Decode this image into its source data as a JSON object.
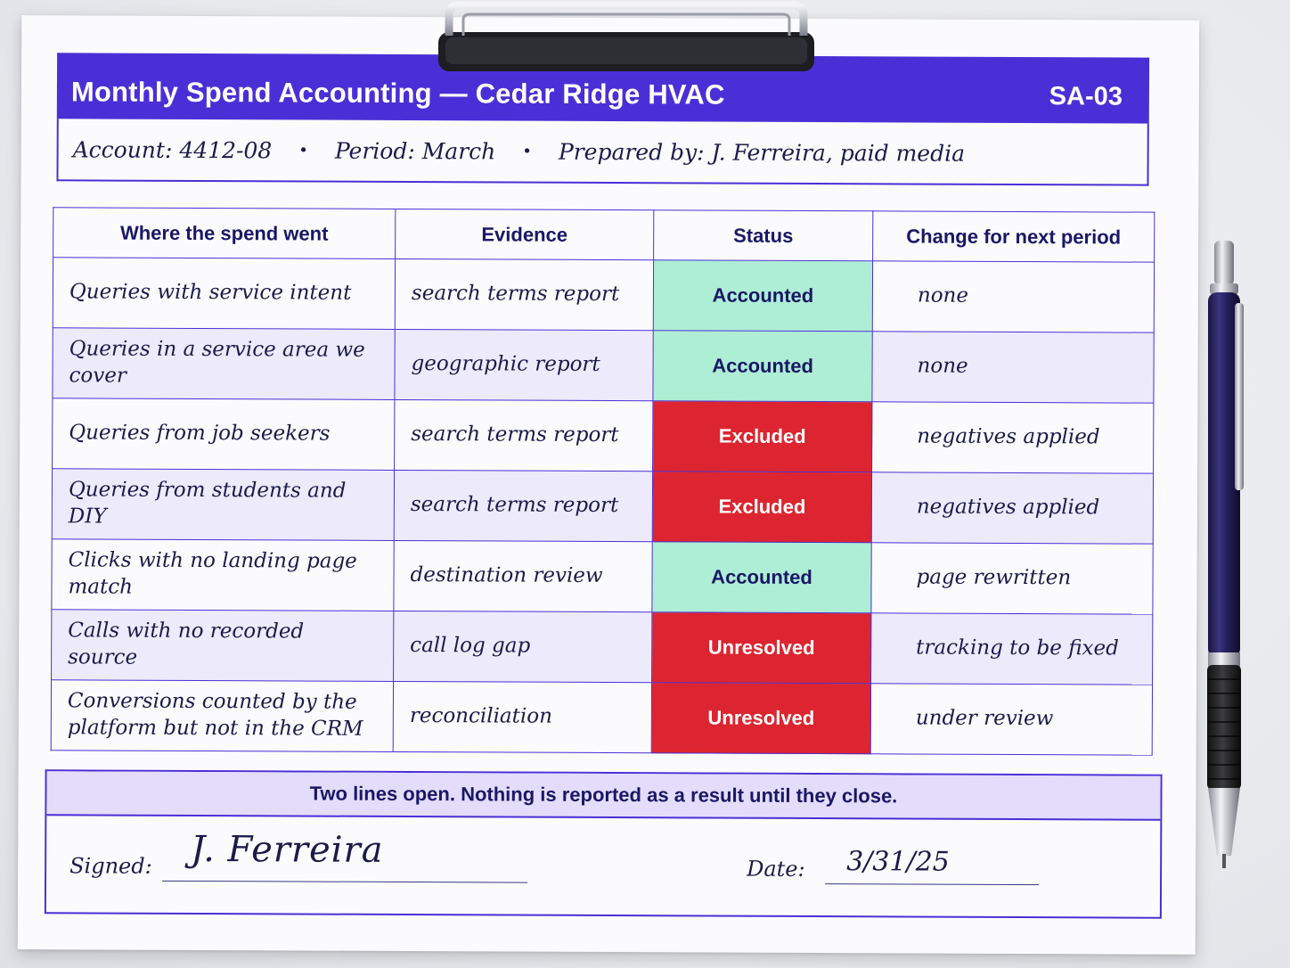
{
  "header": {
    "title": "Monthly Spend Accounting — Cedar Ridge HVAC",
    "code": "SA-03"
  },
  "meta": {
    "account": "Account: 4412-08",
    "period": "Period: March",
    "prepared_by": "Prepared by: J. Ferreira, paid media",
    "separator": "•"
  },
  "table": {
    "columns": [
      "Where the spend went",
      "Evidence",
      "Status",
      "Change for next period"
    ],
    "rows": [
      {
        "where": "Queries with service intent",
        "evidence": "search terms report",
        "status": "Accounted",
        "change": "none"
      },
      {
        "where": "Queries in a service area we cover",
        "evidence": "geographic report",
        "status": "Accounted",
        "change": "none"
      },
      {
        "where": "Queries from job seekers",
        "evidence": "search terms report",
        "status": "Excluded",
        "change": "negatives applied"
      },
      {
        "where": "Queries from students and DIY",
        "evidence": "search terms report",
        "status": "Excluded",
        "change": "negatives applied"
      },
      {
        "where": "Clicks with no landing page match",
        "evidence": "destination review",
        "status": "Accounted",
        "change": "page rewritten"
      },
      {
        "where": "Calls with no recorded source",
        "evidence": "call log gap",
        "status": "Unresolved",
        "change": "tracking to be fixed"
      },
      {
        "where": "Conversions counted by the platform but not in the CRM",
        "evidence": "reconciliation",
        "status": "Unresolved",
        "change": "under review"
      }
    ]
  },
  "summary": "Two lines open. Nothing is reported as a result until they close.",
  "signoff": {
    "signed_label": "Signed:",
    "signature": "J. Ferreira",
    "date_label": "Date:",
    "date_value": "3/31/25"
  },
  "colors": {
    "brand": "#4b2fd6",
    "accounted": "#aeeed5",
    "excluded": "#dc2530",
    "unresolved": "#dc2530",
    "row_alt": "#edeafb"
  },
  "objects": {
    "clip": "clipboard-clip",
    "pen": "ballpoint-pen"
  }
}
